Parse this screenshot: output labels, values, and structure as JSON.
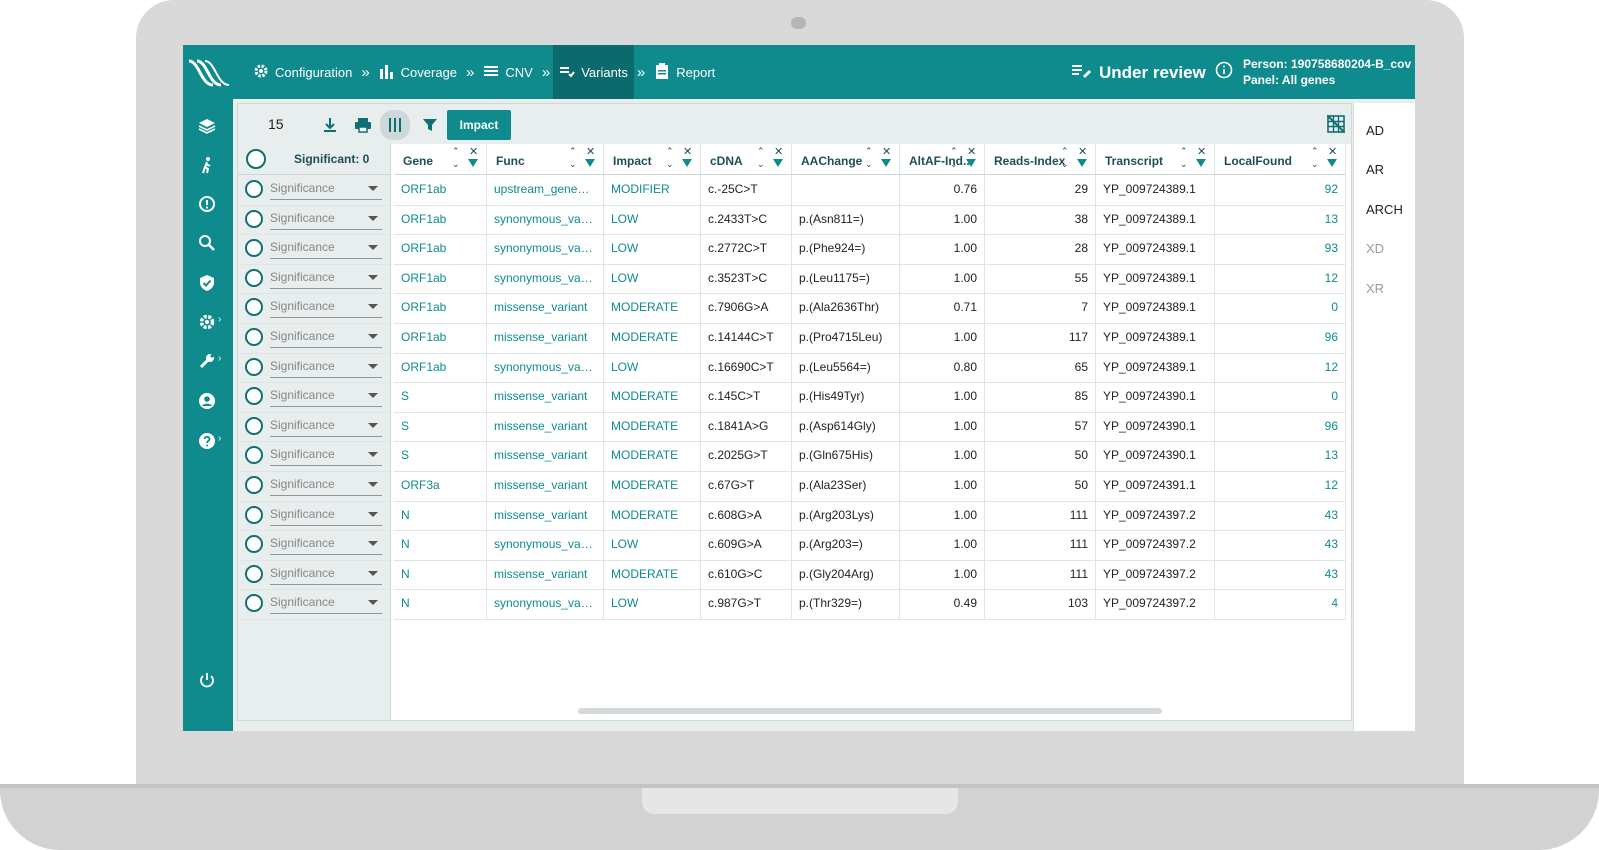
{
  "nav": {
    "items": [
      {
        "label": "Configuration",
        "icon": "gear-icon"
      },
      {
        "label": "Coverage",
        "icon": "bar-chart-icon"
      },
      {
        "label": "CNV",
        "icon": "cnv-icon"
      },
      {
        "label": "Variants",
        "icon": "variants-icon"
      },
      {
        "label": "Report",
        "icon": "clipboard-icon"
      }
    ],
    "active": "Variants",
    "separator": "»"
  },
  "status": {
    "label": "Under review"
  },
  "person": {
    "line1": "Person: 190758680204-B_cov",
    "line2": "Panel: All genes"
  },
  "toolbar": {
    "count": "15",
    "impact_label": "Impact"
  },
  "left": {
    "header": "Significant: 0",
    "placeholder": "Significance"
  },
  "right_panel": {
    "items": [
      {
        "label": "AD",
        "dim": false
      },
      {
        "label": "AR",
        "dim": false
      },
      {
        "label": "ARCH",
        "dim": false
      },
      {
        "label": "XD",
        "dim": true
      },
      {
        "label": "XR",
        "dim": true
      }
    ]
  },
  "columns": [
    "Gene",
    "Func",
    "Impact",
    "cDNA",
    "AAChange",
    "AltAF-Ind...",
    "Reads-Index",
    "Transcript",
    "LocalFound"
  ],
  "rows": [
    [
      "ORF1ab",
      "upstream_gene_v...",
      "MODIFIER",
      "c.-25C>T",
      "",
      "0.76",
      "29",
      "YP_009724389.1",
      "92"
    ],
    [
      "ORF1ab",
      "synonymous_vari...",
      "LOW",
      "c.2433T>C",
      "p.(Asn811=)",
      "1.00",
      "38",
      "YP_009724389.1",
      "13"
    ],
    [
      "ORF1ab",
      "synonymous_vari...",
      "LOW",
      "c.2772C>T",
      "p.(Phe924=)",
      "1.00",
      "28",
      "YP_009724389.1",
      "93"
    ],
    [
      "ORF1ab",
      "synonymous_vari...",
      "LOW",
      "c.3523T>C",
      "p.(Leu1175=)",
      "1.00",
      "55",
      "YP_009724389.1",
      "12"
    ],
    [
      "ORF1ab",
      "missense_variant",
      "MODERATE",
      "c.7906G>A",
      "p.(Ala2636Thr)",
      "0.71",
      "7",
      "YP_009724389.1",
      "0"
    ],
    [
      "ORF1ab",
      "missense_variant",
      "MODERATE",
      "c.14144C>T",
      "p.(Pro4715Leu)",
      "1.00",
      "117",
      "YP_009724389.1",
      "96"
    ],
    [
      "ORF1ab",
      "synonymous_vari...",
      "LOW",
      "c.16690C>T",
      "p.(Leu5564=)",
      "0.80",
      "65",
      "YP_009724389.1",
      "12"
    ],
    [
      "S",
      "missense_variant",
      "MODERATE",
      "c.145C>T",
      "p.(His49Tyr)",
      "1.00",
      "85",
      "YP_009724390.1",
      "0"
    ],
    [
      "S",
      "missense_variant",
      "MODERATE",
      "c.1841A>G",
      "p.(Asp614Gly)",
      "1.00",
      "57",
      "YP_009724390.1",
      "96"
    ],
    [
      "S",
      "missense_variant",
      "MODERATE",
      "c.2025G>T",
      "p.(Gln675His)",
      "1.00",
      "50",
      "YP_009724390.1",
      "13"
    ],
    [
      "ORF3a",
      "missense_variant",
      "MODERATE",
      "c.67G>T",
      "p.(Ala23Ser)",
      "1.00",
      "50",
      "YP_009724391.1",
      "12"
    ],
    [
      "N",
      "missense_variant",
      "MODERATE",
      "c.608G>A",
      "p.(Arg203Lys)",
      "1.00",
      "111",
      "YP_009724397.2",
      "43"
    ],
    [
      "N",
      "synonymous_vari...",
      "LOW",
      "c.609G>A",
      "p.(Arg203=)",
      "1.00",
      "111",
      "YP_009724397.2",
      "43"
    ],
    [
      "N",
      "missense_variant",
      "MODERATE",
      "c.610G>C",
      "p.(Gly204Arg)",
      "1.00",
      "111",
      "YP_009724397.2",
      "43"
    ],
    [
      "N",
      "synonymous_vari...",
      "LOW",
      "c.987G>T",
      "p.(Thr329=)",
      "0.49",
      "103",
      "YP_009724397.2",
      "4"
    ]
  ],
  "colors": {
    "accent": "#0f8b8d",
    "accent_dark": "#0b6a6c",
    "panel_bg": "#e8eded"
  }
}
